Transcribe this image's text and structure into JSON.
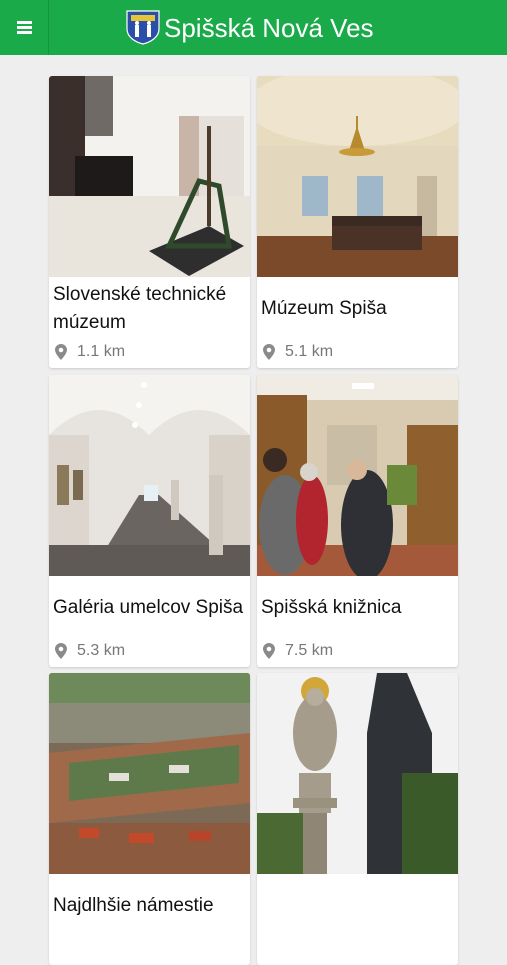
{
  "app": {
    "title": "Spišská Nová Ves",
    "menu_icon": "hamburger-menu-icon",
    "logo_icon": "coat-of-arms-icon",
    "accent": "#1aaa4a"
  },
  "places": [
    {
      "name": "Slovenské technické múzeum",
      "distance": "1.1 km",
      "image": "museum-exhibit-photo"
    },
    {
      "name": "Múzeum Spiša",
      "distance": "5.1 km",
      "image": "museum-hall-photo"
    },
    {
      "name": "Galéria umelcov Spiša",
      "distance": "5.3 km",
      "image": "gallery-arcade-photo"
    },
    {
      "name": "Spišská knižnica",
      "distance": "7.5 km",
      "image": "library-photo"
    },
    {
      "name": "Najdlhšie námestie",
      "distance": "",
      "image": "aerial-town-photo"
    },
    {
      "name": "",
      "distance": "",
      "image": "statue-church-photo"
    }
  ]
}
